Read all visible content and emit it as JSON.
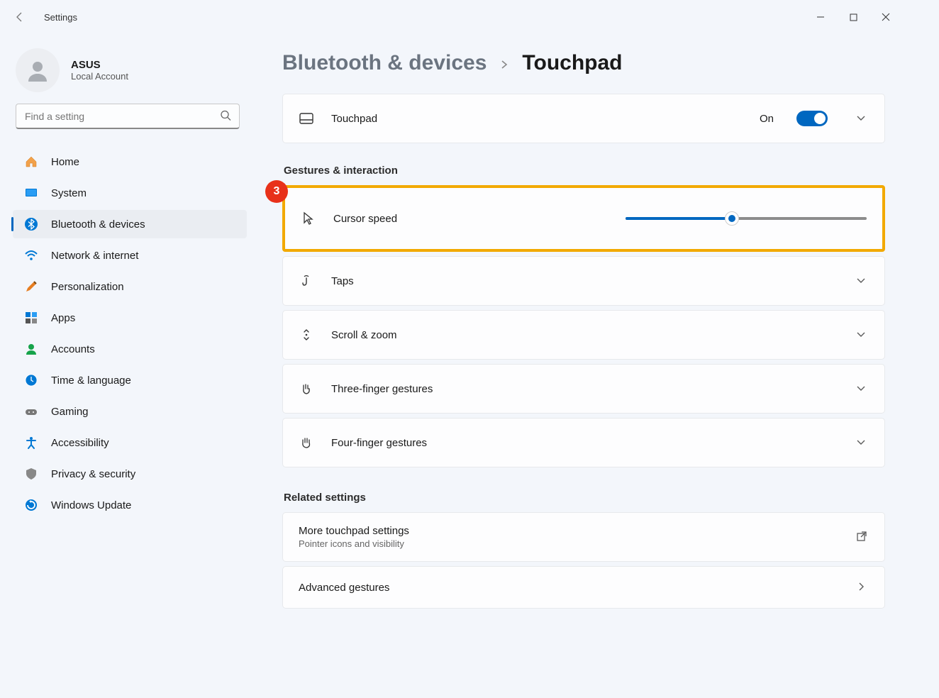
{
  "titlebar": {
    "app_name": "Settings"
  },
  "user": {
    "name": "ASUS",
    "sub": "Local Account"
  },
  "search": {
    "placeholder": "Find a setting"
  },
  "nav": {
    "home": "Home",
    "system": "System",
    "bluetooth": "Bluetooth & devices",
    "network": "Network & internet",
    "personalization": "Personalization",
    "apps": "Apps",
    "accounts": "Accounts",
    "time": "Time & language",
    "gaming": "Gaming",
    "accessibility": "Accessibility",
    "privacy": "Privacy & security",
    "update": "Windows Update"
  },
  "breadcrumb": {
    "parent": "Bluetooth & devices",
    "current": "Touchpad"
  },
  "touchpad_card": {
    "label": "Touchpad",
    "state": "On"
  },
  "sections": {
    "gestures": "Gestures & interaction",
    "related": "Related settings"
  },
  "callout": {
    "number": "3"
  },
  "rows": {
    "cursor_speed": "Cursor speed",
    "taps": "Taps",
    "scroll_zoom": "Scroll & zoom",
    "three_finger": "Three-finger gestures",
    "four_finger": "Four-finger gestures",
    "more_touchpad": "More touchpad settings",
    "more_touchpad_sub": "Pointer icons and visibility",
    "advanced": "Advanced gestures"
  },
  "slider": {
    "percent": 44
  }
}
